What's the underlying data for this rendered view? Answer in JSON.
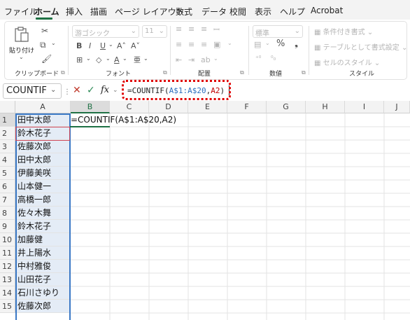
{
  "menu": {
    "tabs": [
      "ファイル",
      "ホーム",
      "挿入",
      "描画",
      "ページ レイアウト",
      "数式",
      "データ",
      "校閲",
      "表示",
      "ヘルプ",
      "Acrobat"
    ],
    "active_tab": "ホーム"
  },
  "ribbon": {
    "clipboard": {
      "label": "クリップボード",
      "paste_label": "貼り付け"
    },
    "font": {
      "label": "フォント",
      "font_name": "游ゴシック",
      "font_size": "11"
    },
    "alignment": {
      "label": "配置"
    },
    "number": {
      "label": "数値",
      "format": "標準"
    },
    "style": {
      "label": "スタイル",
      "conditional_format": "条件付き書式",
      "table_format": "テーブルとして書式設定",
      "cell_style": "セルのスタイル"
    }
  },
  "formula_bar": {
    "name_box": "COUNTIF",
    "fx": "fx",
    "formula_prefix": "=COUNTIF(",
    "ref_range": "A$1:A$20",
    "comma": ",",
    "ref_cell": "A2",
    "formula_suffix": ")"
  },
  "sheet": {
    "columns": [
      "A",
      "B",
      "C",
      "D",
      "E",
      "F",
      "G",
      "H",
      "I",
      "J"
    ],
    "rows": [
      "1",
      "2",
      "3",
      "4",
      "5",
      "6",
      "7",
      "8",
      "9",
      "10",
      "11",
      "12",
      "13",
      "14",
      "15"
    ],
    "column_a": [
      "田中太郎",
      "鈴木花子",
      "佐藤次郎",
      "田中太郎",
      "伊藤美咲",
      "山本健一",
      "高橋一郎",
      "佐々木舞",
      "鈴木花子",
      "加藤健",
      "井上陽水",
      "中村雅俊",
      "山田花子",
      "石川さゆり",
      "佐藤次郎"
    ],
    "b1_text": "=COUNTIF(A$1:A$20,A2)"
  },
  "colors": {
    "accent": "#1f7145",
    "range_ref": "#2c6fbe",
    "cell_ref": "#c00000",
    "highlight": "#e00000"
  }
}
